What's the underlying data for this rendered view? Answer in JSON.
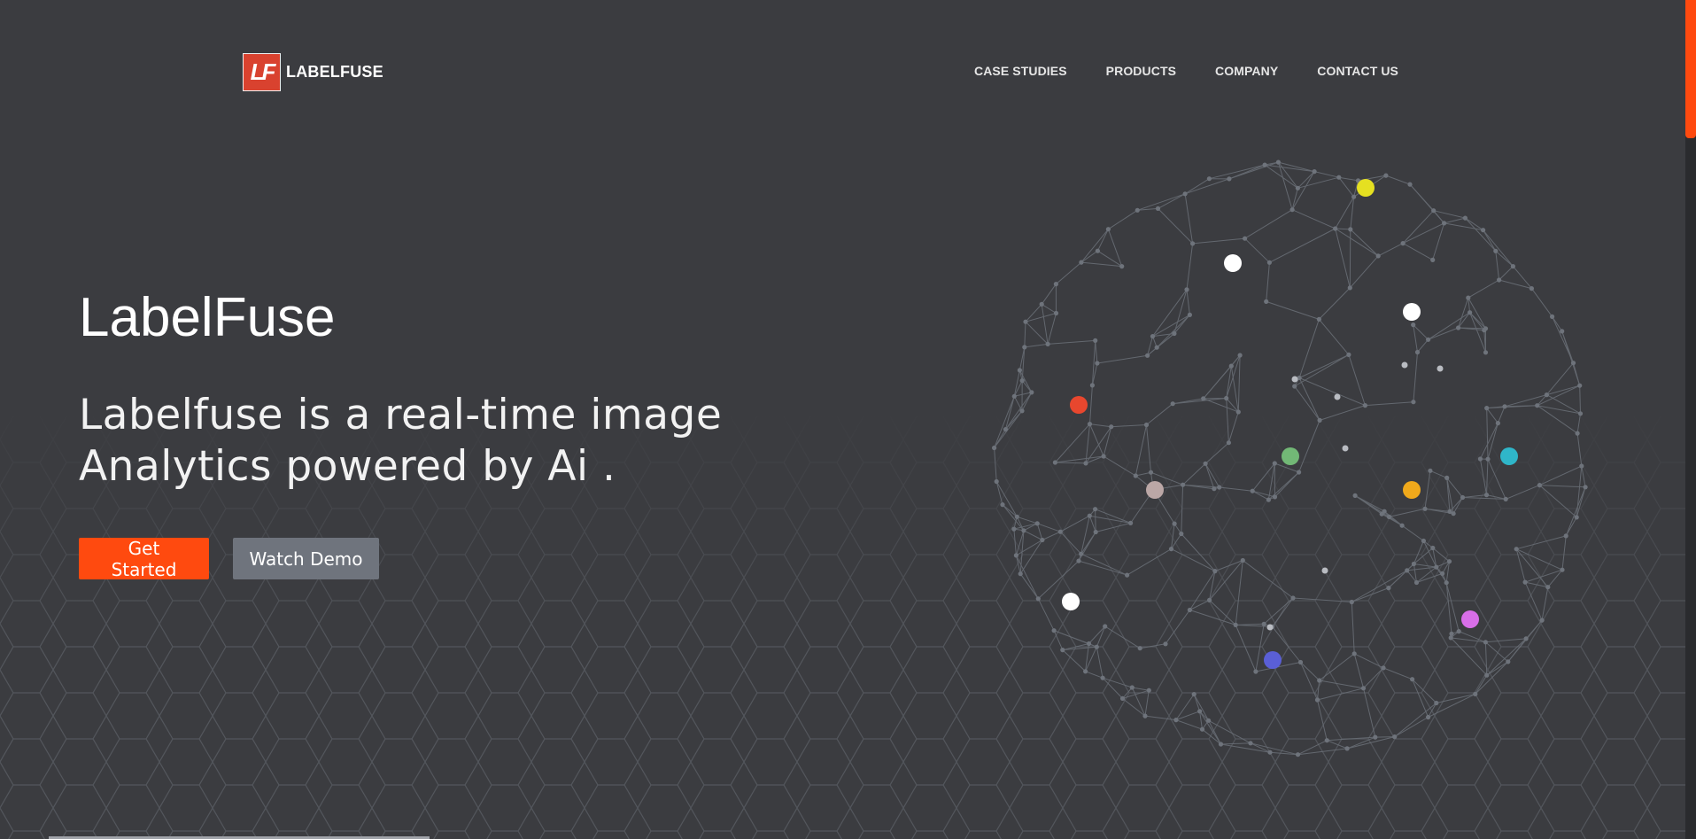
{
  "brand": {
    "logo_mark": "LF",
    "name": "LABELFUSE"
  },
  "nav": {
    "items": [
      {
        "label": "CASE STUDIES"
      },
      {
        "label": "PRODUCTS"
      },
      {
        "label": "COMPANY"
      },
      {
        "label": "CONTACT US"
      }
    ]
  },
  "hero": {
    "title": "LabelFuse",
    "subtitle": "Labelfuse is a real-time image Analytics powered by Ai .",
    "primary_button": "Get Started",
    "secondary_button": "Watch Demo"
  },
  "colors": {
    "background": "#3b3c40",
    "accent": "#ff4a0f",
    "logo": "#d9422f",
    "secondary_button": "#6f747d",
    "mesh_line": "#6b7078",
    "dots": [
      "#e5e021",
      "#ffffff",
      "#ffffff",
      "#e8472e",
      "#72b876",
      "#2fb6c9",
      "#bba7a6",
      "#f0a91b",
      "#ffffff",
      "#d86ee8",
      "#5a5fd6"
    ]
  },
  "icons": {
    "sphere": "network-sphere-illustration",
    "background": "hexagon-pattern"
  }
}
